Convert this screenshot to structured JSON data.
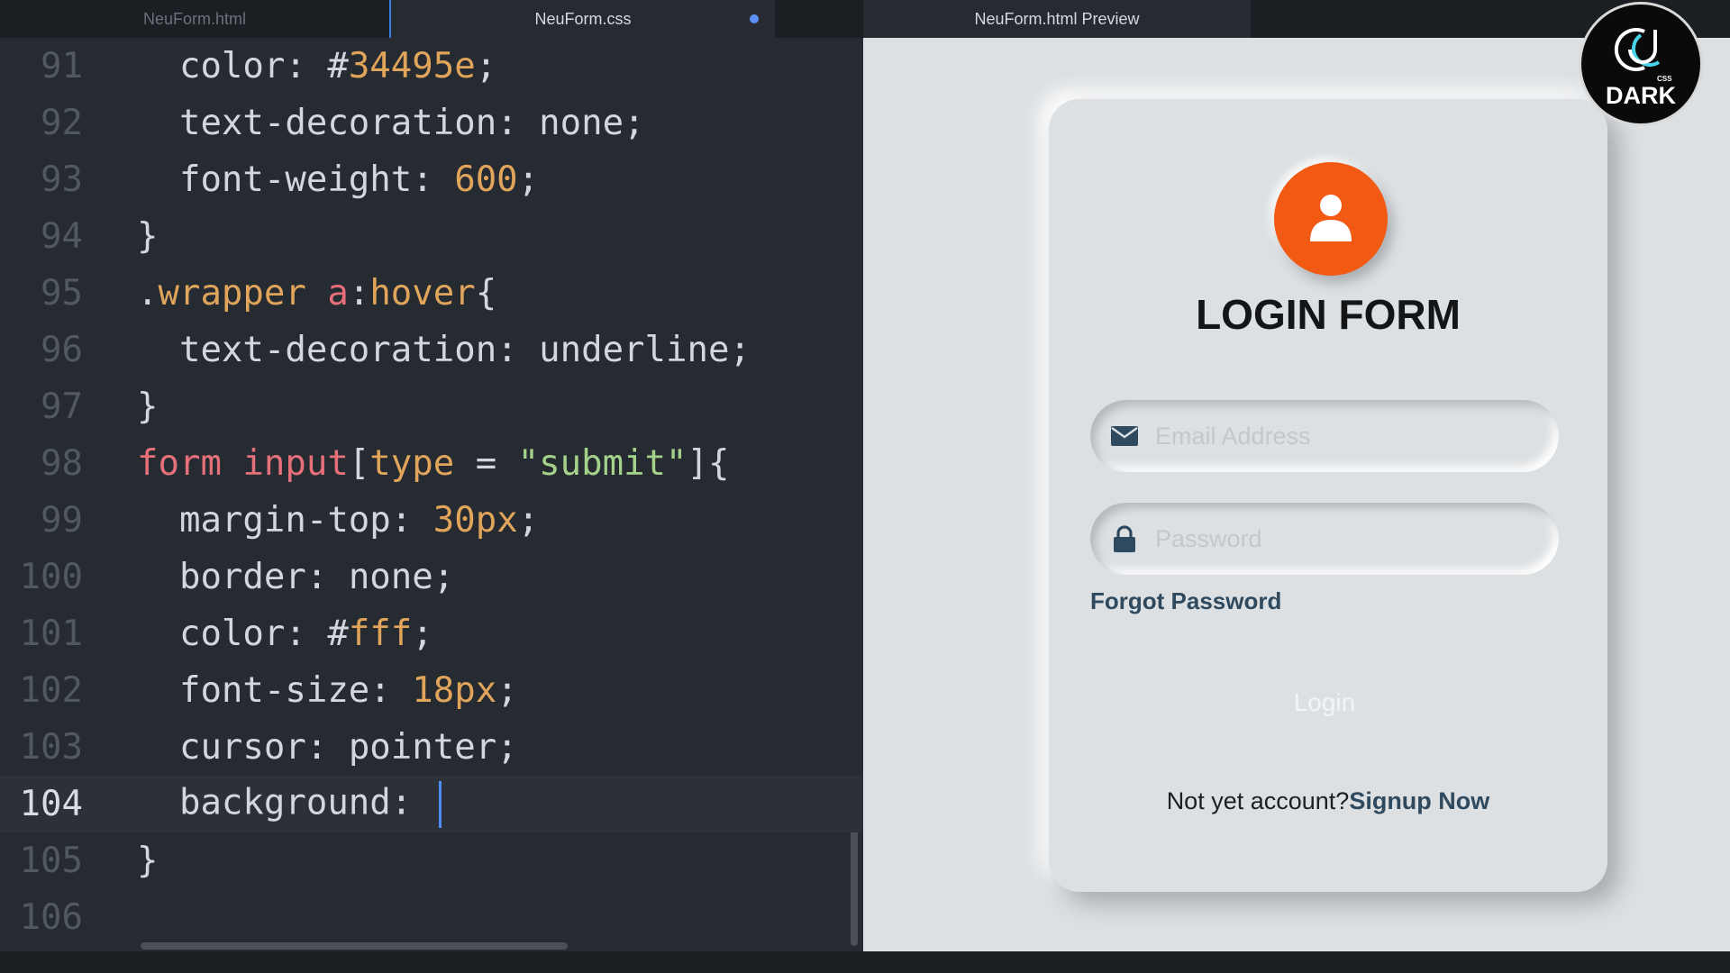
{
  "tabs": {
    "html_file": "NeuForm.html",
    "css_file": "NeuForm.css",
    "preview": "NeuForm.html Preview"
  },
  "editor": {
    "lines": [
      {
        "num": "91",
        "tokens": [
          {
            "t": "color",
            "c": "c-prop"
          },
          {
            "t": ": ",
            "c": "c-punct"
          },
          {
            "t": "#",
            "c": "c-punct"
          },
          {
            "t": "34495e",
            "c": "c-num"
          },
          {
            "t": ";",
            "c": "c-punct"
          }
        ],
        "indent": "  "
      },
      {
        "num": "92",
        "tokens": [
          {
            "t": "text-decoration",
            "c": "c-prop"
          },
          {
            "t": ": none;",
            "c": "c-punct"
          }
        ],
        "indent": "  "
      },
      {
        "num": "93",
        "tokens": [
          {
            "t": "font-weight",
            "c": "c-prop"
          },
          {
            "t": ": ",
            "c": "c-punct"
          },
          {
            "t": "600",
            "c": "c-num"
          },
          {
            "t": ";",
            "c": "c-punct"
          }
        ],
        "indent": "  "
      },
      {
        "num": "94",
        "tokens": [
          {
            "t": "}",
            "c": "c-punct"
          }
        ],
        "indent": ""
      },
      {
        "num": "95",
        "tokens": [
          {
            "t": ".",
            "c": "c-punct"
          },
          {
            "t": "wrapper",
            "c": "c-cls"
          },
          {
            "t": " ",
            "c": "c-punct"
          },
          {
            "t": "a",
            "c": "c-tag"
          },
          {
            "t": ":",
            "c": "c-punct"
          },
          {
            "t": "hover",
            "c": "c-pseudo"
          },
          {
            "t": "{",
            "c": "c-punct"
          }
        ],
        "indent": ""
      },
      {
        "num": "96",
        "tokens": [
          {
            "t": "text-decoration",
            "c": "c-prop"
          },
          {
            "t": ": underline;",
            "c": "c-punct"
          }
        ],
        "indent": "  "
      },
      {
        "num": "97",
        "tokens": [
          {
            "t": "}",
            "c": "c-punct"
          }
        ],
        "indent": ""
      },
      {
        "num": "98",
        "tokens": [
          {
            "t": "form",
            "c": "c-tag"
          },
          {
            "t": " ",
            "c": "c-punct"
          },
          {
            "t": "input",
            "c": "c-tag"
          },
          {
            "t": "[",
            "c": "c-punct"
          },
          {
            "t": "type",
            "c": "c-cls"
          },
          {
            "t": " = ",
            "c": "c-punct"
          },
          {
            "t": "\"submit\"",
            "c": "c-str"
          },
          {
            "t": "]{",
            "c": "c-punct"
          }
        ],
        "indent": ""
      },
      {
        "num": "99",
        "tokens": [
          {
            "t": "margin-top",
            "c": "c-prop"
          },
          {
            "t": ": ",
            "c": "c-punct"
          },
          {
            "t": "30px",
            "c": "c-num"
          },
          {
            "t": ";",
            "c": "c-punct"
          }
        ],
        "indent": "  "
      },
      {
        "num": "100",
        "tokens": [
          {
            "t": "border",
            "c": "c-prop"
          },
          {
            "t": ": none;",
            "c": "c-punct"
          }
        ],
        "indent": "  "
      },
      {
        "num": "101",
        "tokens": [
          {
            "t": "color",
            "c": "c-prop"
          },
          {
            "t": ": ",
            "c": "c-punct"
          },
          {
            "t": "#",
            "c": "c-punct"
          },
          {
            "t": "fff",
            "c": "c-num"
          },
          {
            "t": ";",
            "c": "c-punct"
          }
        ],
        "indent": "  "
      },
      {
        "num": "102",
        "tokens": [
          {
            "t": "font-size",
            "c": "c-prop"
          },
          {
            "t": ": ",
            "c": "c-punct"
          },
          {
            "t": "18px",
            "c": "c-num"
          },
          {
            "t": ";",
            "c": "c-punct"
          }
        ],
        "indent": "  "
      },
      {
        "num": "103",
        "tokens": [
          {
            "t": "cursor",
            "c": "c-prop"
          },
          {
            "t": ": pointer;",
            "c": "c-punct"
          }
        ],
        "indent": "  "
      },
      {
        "num": "104",
        "tokens": [
          {
            "t": "background",
            "c": "c-prop"
          },
          {
            "t": ": ",
            "c": "c-punct"
          }
        ],
        "indent": "  ",
        "active": true
      },
      {
        "num": "105",
        "tokens": [
          {
            "t": "}",
            "c": "c-punct"
          }
        ],
        "indent": ""
      },
      {
        "num": "106",
        "tokens": [],
        "indent": ""
      }
    ]
  },
  "preview": {
    "form_title": "LOGIN FORM",
    "email_placeholder": "Email Address",
    "password_placeholder": "Password",
    "forgot_label": "Forgot Password",
    "login_label": "Login",
    "signup_prompt": "Not yet account?",
    "signup_link": "Signup Now"
  },
  "badge": {
    "label": "DARK",
    "sub": "CSS"
  },
  "colors": {
    "editor_bg": "#262a31",
    "preview_bg": "#dde0e3",
    "avatar": "#f25912",
    "link": "#2f4a5f"
  },
  "icons": {
    "email": "envelope-icon",
    "password": "lock-icon",
    "avatar": "user-icon"
  }
}
